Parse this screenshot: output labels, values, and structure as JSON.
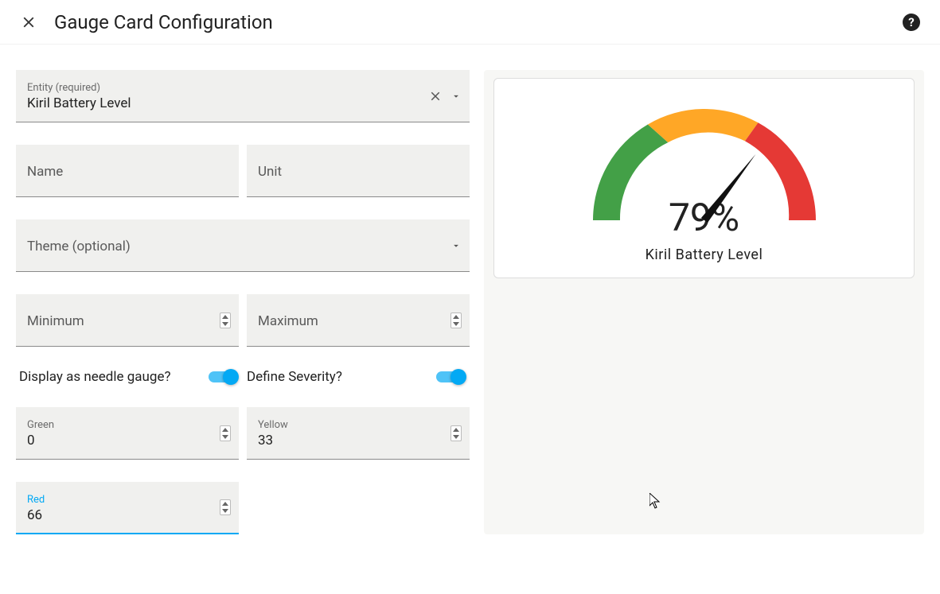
{
  "header": {
    "title": "Gauge Card Configuration"
  },
  "form": {
    "entity": {
      "label": "Entity (required)",
      "value": "Kiril Battery Level"
    },
    "name": {
      "label": "Name",
      "value": ""
    },
    "unit": {
      "label": "Unit",
      "value": ""
    },
    "theme": {
      "label": "Theme (optional)",
      "value": ""
    },
    "minimum": {
      "label": "Minimum",
      "value": ""
    },
    "maximum": {
      "label": "Maximum",
      "value": ""
    },
    "needle_toggle_label": "Display as needle gauge?",
    "severity_toggle_label": "Define Severity?",
    "green": {
      "label": "Green",
      "value": "0"
    },
    "yellow": {
      "label": "Yellow",
      "value": "33"
    },
    "red": {
      "label": "Red",
      "value": "66"
    }
  },
  "preview": {
    "value_text": "79%",
    "label": "Kiril Battery Level"
  },
  "chart_data": {
    "type": "gauge",
    "value": 79,
    "unit": "%",
    "min": 0,
    "max": 100,
    "label": "Kiril Battery Level",
    "needle": true,
    "severity": {
      "green": 0,
      "yellow": 33,
      "red": 66
    }
  }
}
